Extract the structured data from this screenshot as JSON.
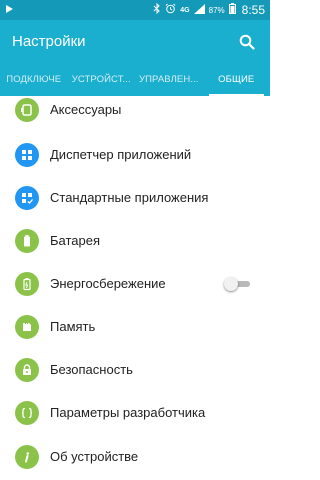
{
  "status_bar": {
    "battery_percent": "87%",
    "time": "8:55",
    "network": "4G"
  },
  "app_bar": {
    "title": "Настройки",
    "search_icon": "search-icon"
  },
  "tabs": [
    {
      "label": "ПОДКЛЮЧЕ",
      "active": false
    },
    {
      "label": "УСТРОЙСТ...",
      "active": false
    },
    {
      "label": "УПРАВЛЕН...",
      "active": false
    },
    {
      "label": "ОБЩИЕ",
      "active": true
    }
  ],
  "settings": [
    {
      "label": "Аксессуары",
      "icon": "accessories-icon",
      "color": "#8bc34a"
    },
    {
      "label": "Диспетчер приложений",
      "icon": "app-manager-icon",
      "color": "#2196f3"
    },
    {
      "label": "Стандартные приложения",
      "icon": "default-apps-icon",
      "color": "#2196f3"
    },
    {
      "label": "Батарея",
      "icon": "battery-icon",
      "color": "#8bc34a"
    },
    {
      "label": "Энергосбережение",
      "icon": "power-saving-icon",
      "color": "#8bc34a",
      "toggle": false
    },
    {
      "label": "Память",
      "icon": "memory-icon",
      "color": "#8bc34a"
    },
    {
      "label": "Безопасность",
      "icon": "lock-icon",
      "color": "#8bc34a"
    },
    {
      "label": "Параметры разработчика",
      "icon": "developer-options-icon",
      "color": "#8bc34a"
    },
    {
      "label": "Об устройстве",
      "icon": "info-icon",
      "color": "#8bc34a"
    }
  ],
  "colors": {
    "status_bar": "#1599b8",
    "app_bar": "#1aaecf",
    "green": "#8bc34a",
    "blue": "#2196f3"
  }
}
